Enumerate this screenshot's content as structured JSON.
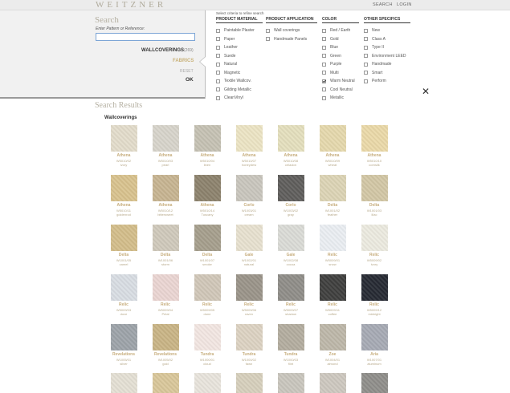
{
  "header": {
    "logo": "WEITZNER",
    "links": [
      "SEARCH",
      "LOGIN"
    ]
  },
  "search": {
    "title": "Search",
    "label": "Enter Pattern or Reference:",
    "value": "",
    "categories": {
      "wallcoverings": "WALLCOVERINGS",
      "wallcoverings_count": "(269)",
      "fabrics": "FABRICS"
    },
    "reset": "RESET",
    "ok": "OK"
  },
  "filters": {
    "instruction": "Select criteria to refine search",
    "groups": [
      {
        "title": "PRODUCT MATERIAL",
        "options": [
          {
            "label": "Paintable Plaster",
            "checked": false
          },
          {
            "label": "Paper",
            "checked": false
          },
          {
            "label": "Leather",
            "checked": false
          },
          {
            "label": "Suede",
            "checked": false
          },
          {
            "label": "Natural",
            "checked": false
          },
          {
            "label": "Magnetic",
            "checked": false
          },
          {
            "label": "Textile Wallcov.",
            "checked": false
          },
          {
            "label": "Gilding Metallic",
            "checked": false
          },
          {
            "label": "CleanVinyl",
            "checked": false
          }
        ]
      },
      {
        "title": "PRODUCT APPLICATION",
        "options": [
          {
            "label": "Wall coverings",
            "checked": false
          },
          {
            "label": "Handmade Panels",
            "checked": false
          }
        ]
      },
      {
        "title": "COLOR",
        "options": [
          {
            "label": "Red / Earth",
            "checked": false
          },
          {
            "label": "Gold",
            "checked": false
          },
          {
            "label": "Blue",
            "checked": false
          },
          {
            "label": "Green",
            "checked": false
          },
          {
            "label": "Purple",
            "checked": false
          },
          {
            "label": "Multi",
            "checked": false
          },
          {
            "label": "Warm Neutral",
            "checked": true
          },
          {
            "label": "Cool Neutral",
            "checked": false
          },
          {
            "label": "Metallic",
            "checked": false
          }
        ]
      },
      {
        "title": "OTHER SPECIFICS",
        "options": [
          {
            "label": "New",
            "checked": false
          },
          {
            "label": "Class A",
            "checked": false
          },
          {
            "label": "Type II",
            "checked": false
          },
          {
            "label": "Environment LEED",
            "checked": false
          },
          {
            "label": "Handmade",
            "checked": false
          },
          {
            "label": "Smart",
            "checked": false
          },
          {
            "label": "Perform",
            "checked": false
          }
        ]
      }
    ]
  },
  "results": {
    "title": "Search Results",
    "section": "Wallcoverings",
    "rows": [
      [
        {
          "name": "Athena",
          "code": "W5010/02",
          "color": "ivory",
          "swatch": "#e3dccb"
        },
        {
          "name": "Athena",
          "code": "W5010/03",
          "color": "pearl",
          "swatch": "#d7d4cb"
        },
        {
          "name": "Athena",
          "code": "W5010/04",
          "color": "linen",
          "swatch": "#c5c1b3"
        },
        {
          "name": "Athena",
          "code": "W5010/07",
          "color": "honeydew",
          "swatch": "#ece4c4"
        },
        {
          "name": "Athena",
          "code": "W5010/08",
          "color": "celadon",
          "swatch": "#e4dfbd"
        },
        {
          "name": "Athena",
          "code": "W5010/09",
          "color": "wheat",
          "swatch": "#e5d8ad"
        },
        {
          "name": "Athena",
          "code": "W5010/10",
          "color": "cornsilk",
          "swatch": "#ead9a8"
        }
      ],
      [
        {
          "name": "Athena",
          "code": "W5010/11",
          "color": "goldenrod",
          "swatch": "#d8c28e"
        },
        {
          "name": "Athena",
          "code": "W5010/12",
          "color": "bittersweet",
          "swatch": "#c7b491"
        },
        {
          "name": "Athena",
          "code": "W5010/14",
          "color": "Tuscany",
          "swatch": "#8c826d"
        },
        {
          "name": "Corlo",
          "code": "W1003/01",
          "color": "cream",
          "swatch": "#c9c6bd"
        },
        {
          "name": "Corlo",
          "code": "W1003/02",
          "color": "gray",
          "swatch": "#5f5e5c"
        },
        {
          "name": "Delta",
          "code": "W1001/02",
          "color": "feather",
          "swatch": "#dcd4b5"
        },
        {
          "name": "Delta",
          "code": "W1001/03",
          "color": "lilac",
          "swatch": "#d2c7a5"
        }
      ],
      [
        {
          "name": "Delta",
          "code": "W1001/05",
          "color": "camel",
          "swatch": "#d3bd8a"
        },
        {
          "name": "Delta",
          "code": "W1001/06",
          "color": "storm",
          "swatch": "#cfc9bb"
        },
        {
          "name": "Delta",
          "code": "W1001/07",
          "color": "smoke",
          "swatch": "#a59e8c"
        },
        {
          "name": "Gale",
          "code": "W1002/01",
          "color": "natural",
          "swatch": "#e7e1cf"
        },
        {
          "name": "Gale",
          "code": "W1002/08",
          "color": "cocoa",
          "swatch": "#dadbd6"
        },
        {
          "name": "Relic",
          "code": "W5009/01",
          "color": "snow",
          "swatch": "#eaeef2"
        },
        {
          "name": "Relic",
          "code": "W5009/02",
          "color": "ivory",
          "swatch": "#eceae0"
        }
      ],
      [
        {
          "name": "Relic",
          "code": "W5009/03",
          "color": "dove",
          "swatch": "#d8dde3"
        },
        {
          "name": "Relic",
          "code": "W5009/04",
          "color": "Petal",
          "swatch": "#ead5d2"
        },
        {
          "name": "Relic",
          "code": "W5009/05",
          "color": "dune",
          "swatch": "#d0c7b8"
        },
        {
          "name": "Relic",
          "code": "W5009/06",
          "color": "raven",
          "swatch": "#9a9489"
        },
        {
          "name": "Relic",
          "code": "W5009/07",
          "color": "shadow",
          "swatch": "#8f8d88"
        },
        {
          "name": "Relic",
          "code": "W5009/11",
          "color": "coffee",
          "swatch": "#3f3f3e"
        },
        {
          "name": "Relic",
          "code": "W5009/12",
          "color": "midnight",
          "swatch": "#262a33"
        }
      ],
      [
        {
          "name": "Revelations",
          "code": "W1005/01",
          "color": "silver",
          "swatch": "#9da3a9"
        },
        {
          "name": "Revelations",
          "code": "W1005/02",
          "color": "gold",
          "swatch": "#c9b485"
        },
        {
          "name": "Tundra",
          "code": "W1000/01",
          "color": "cloud",
          "swatch": "#f2e6e2"
        },
        {
          "name": "Tundra",
          "code": "W1000/02",
          "color": "fawn",
          "swatch": "#dcd2c2"
        },
        {
          "name": "Tundra",
          "code": "W1000/03",
          "color": "flint",
          "swatch": "#b3ad9f"
        },
        {
          "name": "Zoe",
          "code": "W1004/01",
          "color": "almond",
          "swatch": "#bdb7a9"
        },
        {
          "name": "Aria",
          "code": "W1007/01",
          "color": "aluminum",
          "swatch": "#a6aab4"
        }
      ],
      [
        {
          "name": "",
          "code": "",
          "color": "",
          "swatch": "#e4e0d4"
        },
        {
          "name": "",
          "code": "",
          "color": "",
          "swatch": "#d9c79a"
        },
        {
          "name": "",
          "code": "",
          "color": "",
          "swatch": "#e8e4dc"
        },
        {
          "name": "",
          "code": "",
          "color": "",
          "swatch": "#d6cfbc"
        },
        {
          "name": "",
          "code": "",
          "color": "",
          "swatch": "#c9c6bd"
        },
        {
          "name": "",
          "code": "",
          "color": "",
          "swatch": "#cdc8bf"
        },
        {
          "name": "",
          "code": "",
          "color": "",
          "swatch": "#8f8e8a"
        }
      ]
    ]
  }
}
